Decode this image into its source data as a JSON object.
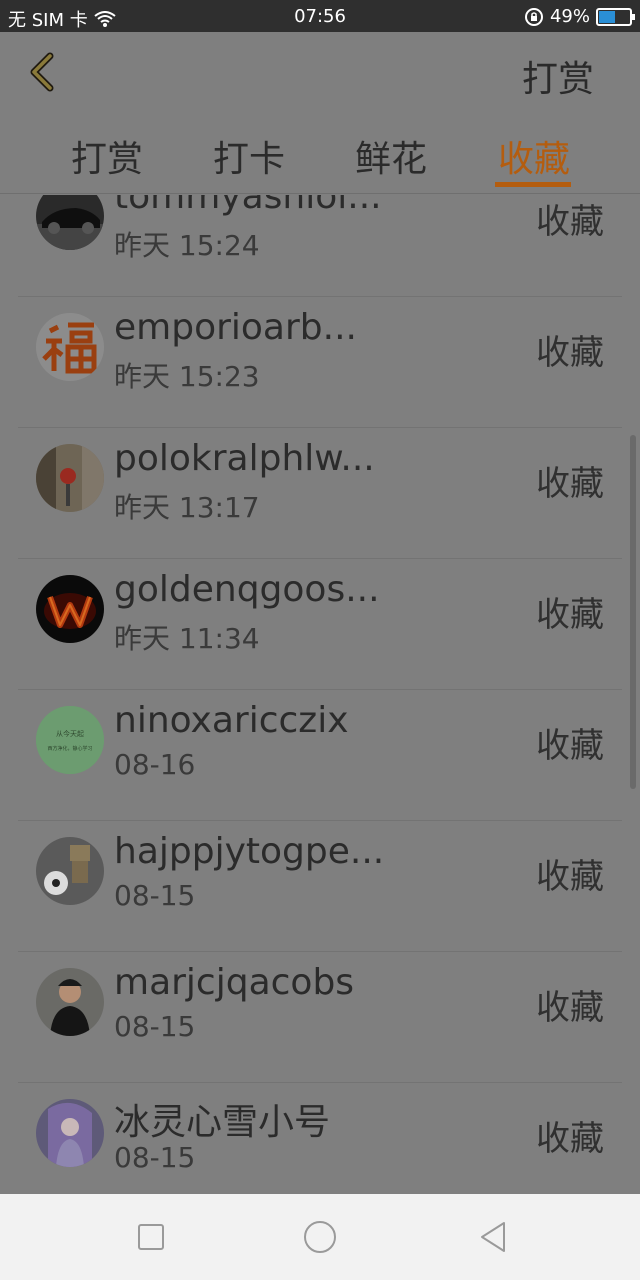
{
  "status": {
    "carrier": "无 SIM 卡",
    "time": "07:56",
    "battery_percent": "49%"
  },
  "header": {
    "title": "打赏"
  },
  "tabs": [
    {
      "label": "打赏",
      "active": false
    },
    {
      "label": "打卡",
      "active": false
    },
    {
      "label": "鲜花",
      "active": false
    },
    {
      "label": "收藏",
      "active": true
    }
  ],
  "items": [
    {
      "name": "tommyashiol...",
      "time": "昨天 15:24",
      "action": "收藏",
      "avatar": "car-avatar"
    },
    {
      "name": "emporioarb...",
      "time": "昨天 15:23",
      "action": "收藏",
      "avatar": "fu-character-avatar"
    },
    {
      "name": "polokralphlw...",
      "time": "昨天 13:17",
      "action": "收藏",
      "avatar": "sign-avatar"
    },
    {
      "name": "goldenqgoos...",
      "time": "昨天 11:34",
      "action": "收藏",
      "avatar": "fire-w-avatar"
    },
    {
      "name": "ninoxaricczix",
      "time": "08-16",
      "action": "收藏",
      "avatar": "green-text-avatar"
    },
    {
      "name": "hajppjytogpe...",
      "time": "08-15",
      "action": "收藏",
      "avatar": "robot-ball-avatar"
    },
    {
      "name": "marjcjqacobs",
      "time": "08-15",
      "action": "收藏",
      "avatar": "person-avatar"
    },
    {
      "name": "冰灵心雪小号",
      "time": "08-15",
      "action": "收藏",
      "avatar": "anime-avatar"
    }
  ],
  "avatar_text": {
    "green_line1": "从今天起",
    "green_line2": "西方净化，静心学习"
  },
  "colors": {
    "accent": "#b45d0f",
    "overlay_bg": "#7f7f7f"
  }
}
